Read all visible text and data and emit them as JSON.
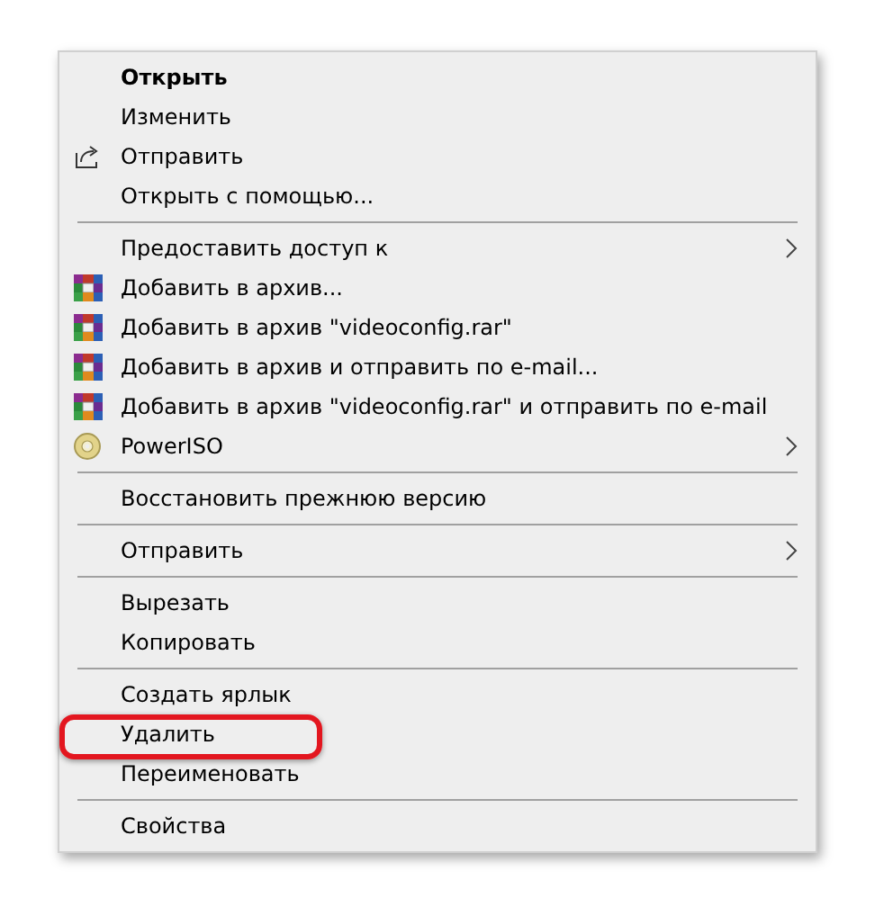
{
  "menu": {
    "groups": [
      {
        "items": [
          {
            "label": "Открыть",
            "kind": "plain",
            "default": true,
            "submenu": false,
            "highlighted": false
          },
          {
            "label": "Изменить",
            "kind": "plain",
            "default": false,
            "submenu": false,
            "highlighted": false
          },
          {
            "label": "Отправить",
            "kind": "share",
            "default": false,
            "submenu": false,
            "highlighted": false
          },
          {
            "label": "Открыть с помощью...",
            "kind": "plain",
            "default": false,
            "submenu": false,
            "highlighted": false
          }
        ]
      },
      {
        "items": [
          {
            "label": "Предоставить доступ к",
            "kind": "plain",
            "default": false,
            "submenu": true,
            "highlighted": false
          },
          {
            "label": "Добавить в архив...",
            "kind": "archive",
            "default": false,
            "submenu": false,
            "highlighted": false
          },
          {
            "label": "Добавить в архив \"videoconfig.rar\"",
            "kind": "archive",
            "default": false,
            "submenu": false,
            "highlighted": false
          },
          {
            "label": "Добавить в архив и отправить по e-mail...",
            "kind": "archive",
            "default": false,
            "submenu": false,
            "highlighted": false
          },
          {
            "label": "Добавить в архив \"videoconfig.rar\" и отправить по e-mail",
            "kind": "archive",
            "default": false,
            "submenu": false,
            "highlighted": false
          },
          {
            "label": "PowerISO",
            "kind": "disc",
            "default": false,
            "submenu": true,
            "highlighted": false
          }
        ]
      },
      {
        "items": [
          {
            "label": "Восстановить прежнюю версию",
            "kind": "plain",
            "default": false,
            "submenu": false,
            "highlighted": false
          }
        ]
      },
      {
        "items": [
          {
            "label": "Отправить",
            "kind": "plain",
            "default": false,
            "submenu": true,
            "highlighted": false
          }
        ]
      },
      {
        "items": [
          {
            "label": "Вырезать",
            "kind": "plain",
            "default": false,
            "submenu": false,
            "highlighted": false
          },
          {
            "label": "Копировать",
            "kind": "plain",
            "default": false,
            "submenu": false,
            "highlighted": false
          }
        ]
      },
      {
        "items": [
          {
            "label": "Создать ярлык",
            "kind": "plain",
            "default": false,
            "submenu": false,
            "highlighted": false
          },
          {
            "label": "Удалить",
            "kind": "plain",
            "default": false,
            "submenu": false,
            "highlighted": true
          },
          {
            "label": "Переименовать",
            "kind": "plain",
            "default": false,
            "submenu": false,
            "highlighted": false
          }
        ]
      },
      {
        "items": [
          {
            "label": "Свойства",
            "kind": "plain",
            "default": false,
            "submenu": false,
            "highlighted": false
          }
        ]
      }
    ]
  }
}
